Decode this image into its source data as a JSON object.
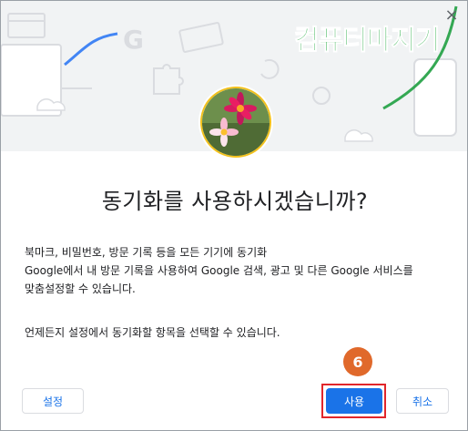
{
  "dialog": {
    "close_glyph": "×",
    "watermark": "컴퓨터마지기",
    "title": "동기화를 사용하시겠습니까?",
    "description_lines": [
      "북마크, 비밀번호, 방문 기록 등을 모든 기기에 동기화",
      "Google에서 내 방문 기록을 사용하여 Google 검색, 광고 및 다른 Google 서비스를",
      "맞춤설정할 수 있습니다."
    ],
    "note": "언제든지 설정에서 동기화할 항목을 선택할 수 있습니다.",
    "buttons": {
      "settings": "설정",
      "use": "사용",
      "cancel": "취소"
    },
    "step_badge": "6"
  },
  "colors": {
    "accent_blue": "#1a73e8",
    "highlight_red": "#e1262b",
    "badge_orange": "#e0692b",
    "watermark_green": "#1ea83c"
  }
}
